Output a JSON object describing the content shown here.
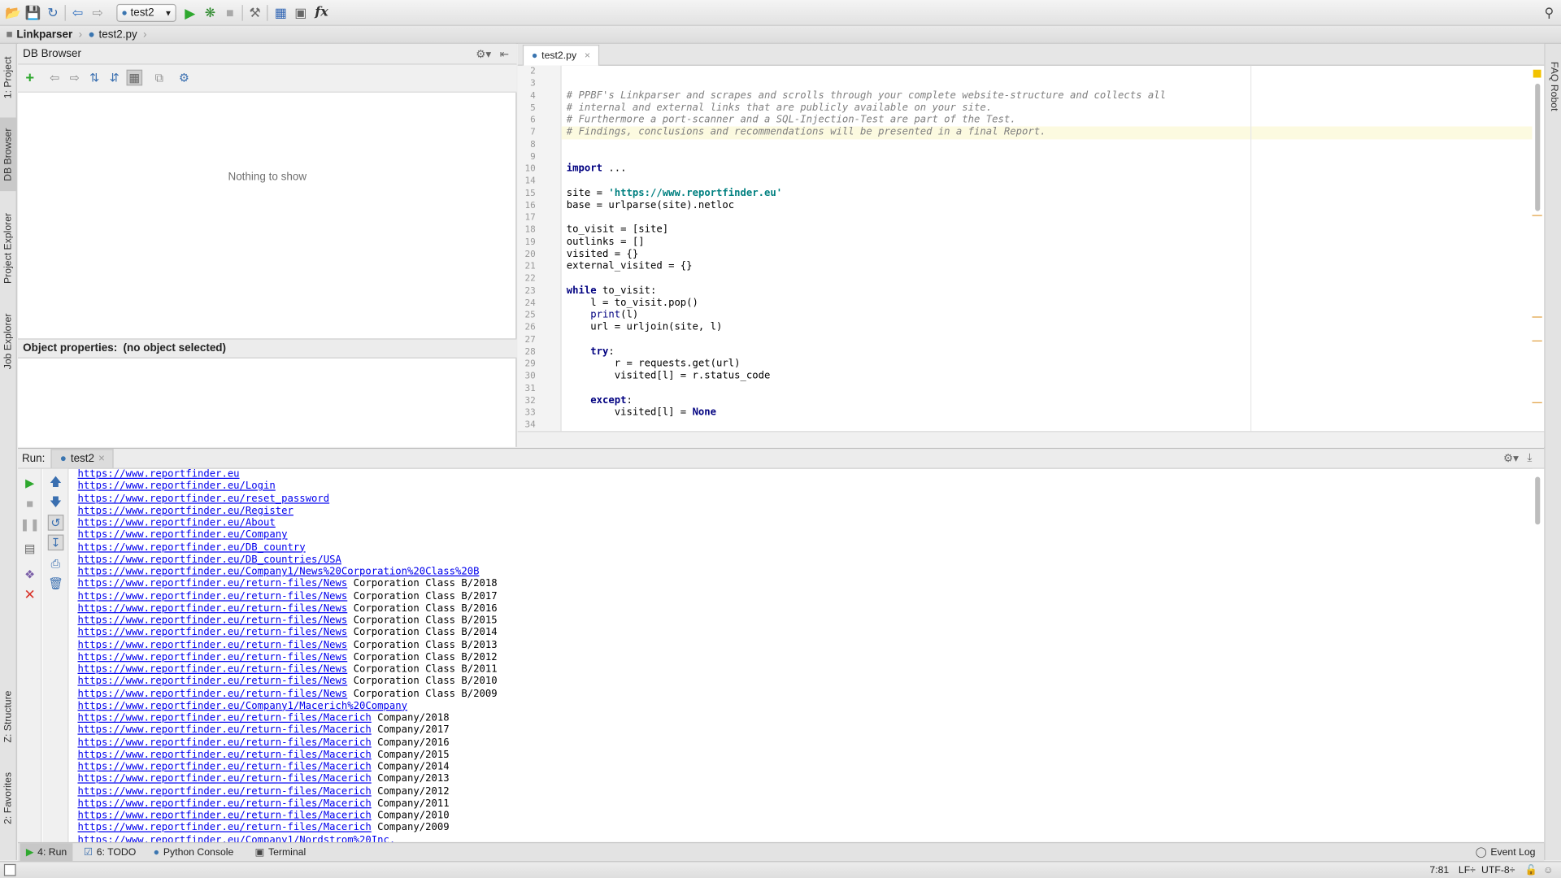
{
  "toolbar": {
    "run_config": "test2",
    "fx_label": "fx"
  },
  "navbar": {
    "project": "Linkparser",
    "file": "test2.py"
  },
  "left_tabs": {
    "project": "1: Project",
    "db_browser": "DB Browser",
    "project_explorer": "Project Explorer",
    "job_explorer": "Job Explorer",
    "structure": "Z: Structure",
    "favorites": "2: Favorites"
  },
  "right_tabs": {
    "faq_robot": "FAQ Robot"
  },
  "db_browser": {
    "title": "DB Browser",
    "empty_text": "Nothing to show",
    "object_properties_label": "Object properties:",
    "object_properties_value": "(no object selected)"
  },
  "editor": {
    "tab_label": "test2.py",
    "line_numbers": [
      "2",
      "3",
      "4",
      "5",
      "6",
      "7",
      "8",
      "9",
      "10",
      "14",
      "15",
      "16",
      "17",
      "18",
      "19",
      "20",
      "21",
      "22",
      "23",
      "24",
      "25",
      "26",
      "27",
      "28",
      "29",
      "30",
      "31",
      "32",
      "33",
      "34"
    ],
    "code_lines": [
      "",
      "",
      "# PPBF's Linkparser and scrapes and scrolls through your complete website-structure and collects all",
      "# internal and external links that are publicly available on your site.",
      "# Furthermore a port-scanner and a SQL-Injection-Test are part of the Test.",
      "# Findings, conclusions and recommendations will be presented in a final Report.",
      "",
      "",
      "import ...",
      "",
      "site = 'https://www.reportfinder.eu'",
      "base = urlparse(site).netloc",
      "",
      "to_visit = [site]",
      "outlinks = []",
      "visited = {}",
      "external_visited = {}",
      "",
      "while to_visit:",
      "    l = to_visit.pop()",
      "    print(l)",
      "    url = urljoin(site, l)",
      "",
      "    try:",
      "        r = requests.get(url)",
      "        visited[l] = r.status_code",
      "",
      "    except:",
      "        visited[l] = None",
      ""
    ]
  },
  "run_panel": {
    "label": "Run:",
    "tab_label": "test2",
    "output": [
      {
        "link": "https://www.reportfinder.eu",
        "text": ""
      },
      {
        "link": "https://www.reportfinder.eu/Login",
        "text": ""
      },
      {
        "link": "https://www.reportfinder.eu/reset_password",
        "text": ""
      },
      {
        "link": "https://www.reportfinder.eu/Register",
        "text": ""
      },
      {
        "link": "https://www.reportfinder.eu/About",
        "text": ""
      },
      {
        "link": "https://www.reportfinder.eu/Company",
        "text": ""
      },
      {
        "link": "https://www.reportfinder.eu/DB_country",
        "text": ""
      },
      {
        "link": "https://www.reportfinder.eu/DB_countries/USA",
        "text": ""
      },
      {
        "link": "https://www.reportfinder.eu/Company1/News%20Corporation%20Class%20B",
        "text": ""
      },
      {
        "link": "https://www.reportfinder.eu/return-files/News",
        "text": " Corporation Class B/2018"
      },
      {
        "link": "https://www.reportfinder.eu/return-files/News",
        "text": " Corporation Class B/2017"
      },
      {
        "link": "https://www.reportfinder.eu/return-files/News",
        "text": " Corporation Class B/2016"
      },
      {
        "link": "https://www.reportfinder.eu/return-files/News",
        "text": " Corporation Class B/2015"
      },
      {
        "link": "https://www.reportfinder.eu/return-files/News",
        "text": " Corporation Class B/2014"
      },
      {
        "link": "https://www.reportfinder.eu/return-files/News",
        "text": " Corporation Class B/2013"
      },
      {
        "link": "https://www.reportfinder.eu/return-files/News",
        "text": " Corporation Class B/2012"
      },
      {
        "link": "https://www.reportfinder.eu/return-files/News",
        "text": " Corporation Class B/2011"
      },
      {
        "link": "https://www.reportfinder.eu/return-files/News",
        "text": " Corporation Class B/2010"
      },
      {
        "link": "https://www.reportfinder.eu/return-files/News",
        "text": " Corporation Class B/2009"
      },
      {
        "link": "https://www.reportfinder.eu/Company1/Macerich%20Company",
        "text": ""
      },
      {
        "link": "https://www.reportfinder.eu/return-files/Macerich",
        "text": " Company/2018"
      },
      {
        "link": "https://www.reportfinder.eu/return-files/Macerich",
        "text": " Company/2017"
      },
      {
        "link": "https://www.reportfinder.eu/return-files/Macerich",
        "text": " Company/2016"
      },
      {
        "link": "https://www.reportfinder.eu/return-files/Macerich",
        "text": " Company/2015"
      },
      {
        "link": "https://www.reportfinder.eu/return-files/Macerich",
        "text": " Company/2014"
      },
      {
        "link": "https://www.reportfinder.eu/return-files/Macerich",
        "text": " Company/2013"
      },
      {
        "link": "https://www.reportfinder.eu/return-files/Macerich",
        "text": " Company/2012"
      },
      {
        "link": "https://www.reportfinder.eu/return-files/Macerich",
        "text": " Company/2011"
      },
      {
        "link": "https://www.reportfinder.eu/return-files/Macerich",
        "text": " Company/2010"
      },
      {
        "link": "https://www.reportfinder.eu/return-files/Macerich",
        "text": " Company/2009"
      },
      {
        "link": "https://www.reportfinder.eu/Company1/Nordstrom%20Inc.",
        "text": ""
      }
    ]
  },
  "tool_tabs": {
    "run": "4: Run",
    "todo": "6: TODO",
    "python_console": "Python Console",
    "terminal": "Terminal",
    "event_log": "Event Log"
  },
  "status_bar": {
    "position": "7:81",
    "line_separator": "LF÷",
    "encoding": "UTF-8÷"
  },
  "colors": {
    "link": "#0000ee",
    "comment": "#808080",
    "keyword": "#000080",
    "string": "#008080",
    "current_line": "#fcfae0"
  }
}
